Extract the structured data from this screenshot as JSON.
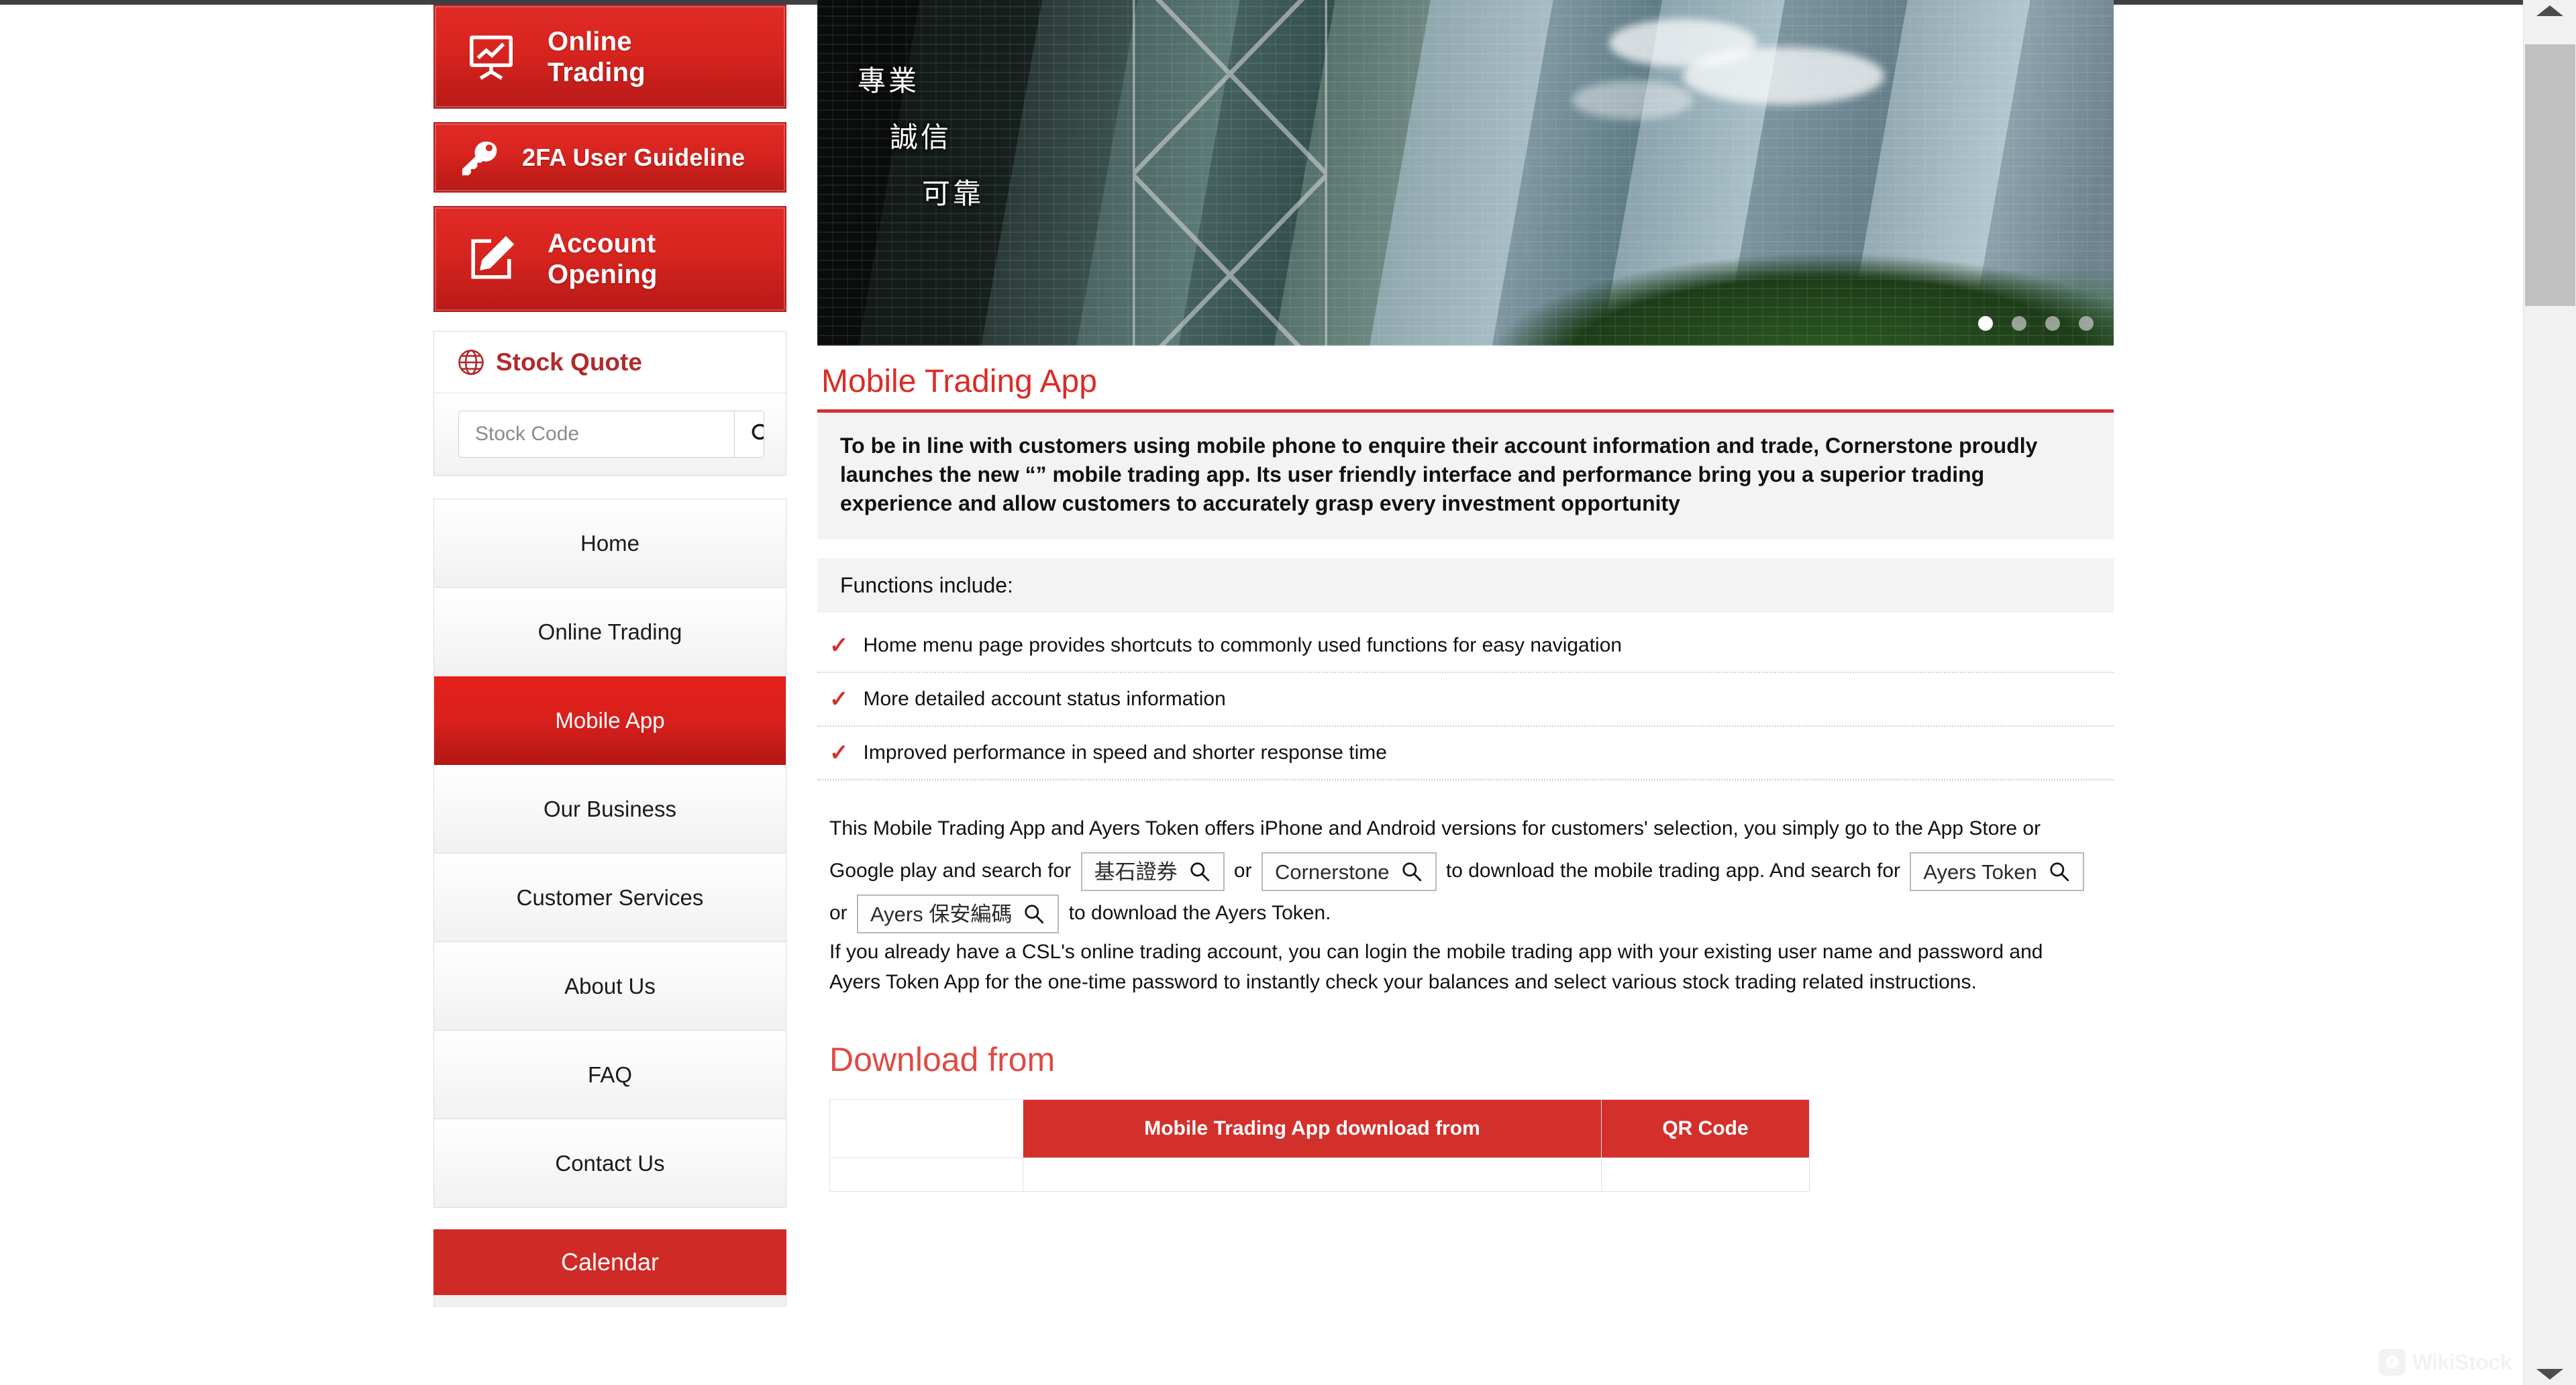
{
  "sidebar": {
    "promos": [
      {
        "label": "Online\nTrading",
        "icon": "chart-board-icon",
        "name": "online-trading"
      },
      {
        "label": "2FA User Guideline",
        "icon": "key-icon",
        "name": "2fa-user-guideline"
      },
      {
        "label": "Account\nOpening",
        "icon": "edit-document-icon",
        "name": "account-opening"
      }
    ],
    "promo_online_line1": "Online",
    "promo_online_line2": "Trading",
    "promo_2fa": "2FA User Guideline",
    "promo_account_line1": "Account",
    "promo_account_line2": "Opening",
    "stock_quote": {
      "title": "Stock Quote",
      "placeholder": "Stock Code",
      "value": ""
    },
    "nav": [
      {
        "label": "Home",
        "active": false
      },
      {
        "label": "Online Trading",
        "active": false
      },
      {
        "label": "Mobile App",
        "active": true
      },
      {
        "label": "Our Business",
        "active": false
      },
      {
        "label": "Customer Services",
        "active": false
      },
      {
        "label": "About Us",
        "active": false
      },
      {
        "label": "FAQ",
        "active": false
      },
      {
        "label": "Contact Us",
        "active": false
      }
    ],
    "calendar_label": "Calendar"
  },
  "hero": {
    "slogan_line1": "專業",
    "slogan_line2": "誠信",
    "slogan_line3": "可靠",
    "dots_total": 4,
    "active_dot": 1
  },
  "main": {
    "page_title": "Mobile Trading App",
    "intro": "To be in line with customers using mobile phone to enquire their account information and trade, Cornerstone proudly launches the new “” mobile trading app. Its user friendly interface and performance bring you a superior trading experience and allow customers to accurately grasp every investment opportunity",
    "functions_heading": "Functions include:",
    "functions": [
      "Home menu page provides shortcuts to commonly used functions for easy navigation",
      "More detailed account status information",
      "Improved performance in speed and shorter response time"
    ],
    "para1_a": "This Mobile Trading App and Ayers Token offers iPhone and Android versions for customers' selection, you simply go to the App Store or Google play and search for",
    "pill_1": "基石證券",
    "para1_or": "or",
    "pill_2": "Cornerstone",
    "para1_b": "to download the mobile trading app. And search for",
    "pill_3": "Ayers Token",
    "para1_or2": "or",
    "pill_4": "Ayers 保安編碼",
    "para1_c": "to download the Ayers Token.",
    "para2": "If you already have a CSL's online trading account, you can login the mobile trading app with your existing user name and password and Ayers Token App for the one-time password to instantly check your balances and select various stock trading related instructions.",
    "download_heading": "Download from",
    "table": {
      "headers": [
        "",
        "Mobile Trading App download from",
        "QR Code"
      ]
    }
  },
  "watermark": {
    "text": "WikiStock"
  },
  "colors": {
    "brand_red": "#d3302c",
    "promo_red": "#cf2a26",
    "title_red": "#dd2b25",
    "quote_title_red": "#b02b2b",
    "panel_gray": "#f3f3f3"
  }
}
